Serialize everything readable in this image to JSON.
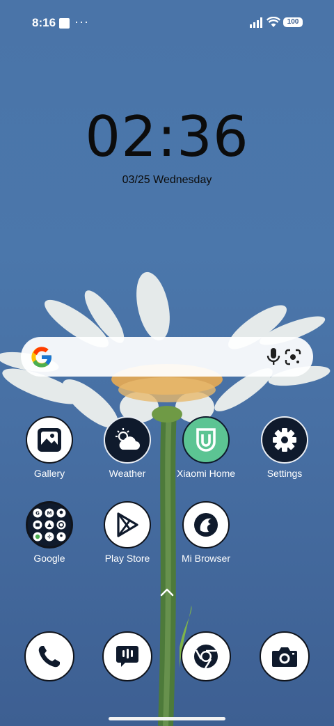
{
  "status_bar": {
    "time": "8:16",
    "more": "···",
    "battery": "100"
  },
  "clock": {
    "time": "02:36",
    "date": "03/25 Wednesday"
  },
  "search": {
    "placeholder": ""
  },
  "apps": [
    {
      "label": "Gallery",
      "icon": "gallery-icon"
    },
    {
      "label": "Weather",
      "icon": "weather-icon"
    },
    {
      "label": "Xiaomi Home",
      "icon": "xiaomi-home-icon"
    },
    {
      "label": "Settings",
      "icon": "gear-icon"
    },
    {
      "label": "Google",
      "icon": "google-folder-icon"
    },
    {
      "label": "Play Store",
      "icon": "play-store-icon"
    },
    {
      "label": "Mi Browser",
      "icon": "mi-browser-icon"
    }
  ],
  "dock": [
    {
      "icon": "phone-icon"
    },
    {
      "icon": "messages-icon"
    },
    {
      "icon": "chrome-icon"
    },
    {
      "icon": "camera-icon"
    }
  ],
  "colors": {
    "wallpaper": "#4a74a8",
    "icon_dark": "#0f1a2c",
    "xiaomi_green": "#5cc493"
  }
}
